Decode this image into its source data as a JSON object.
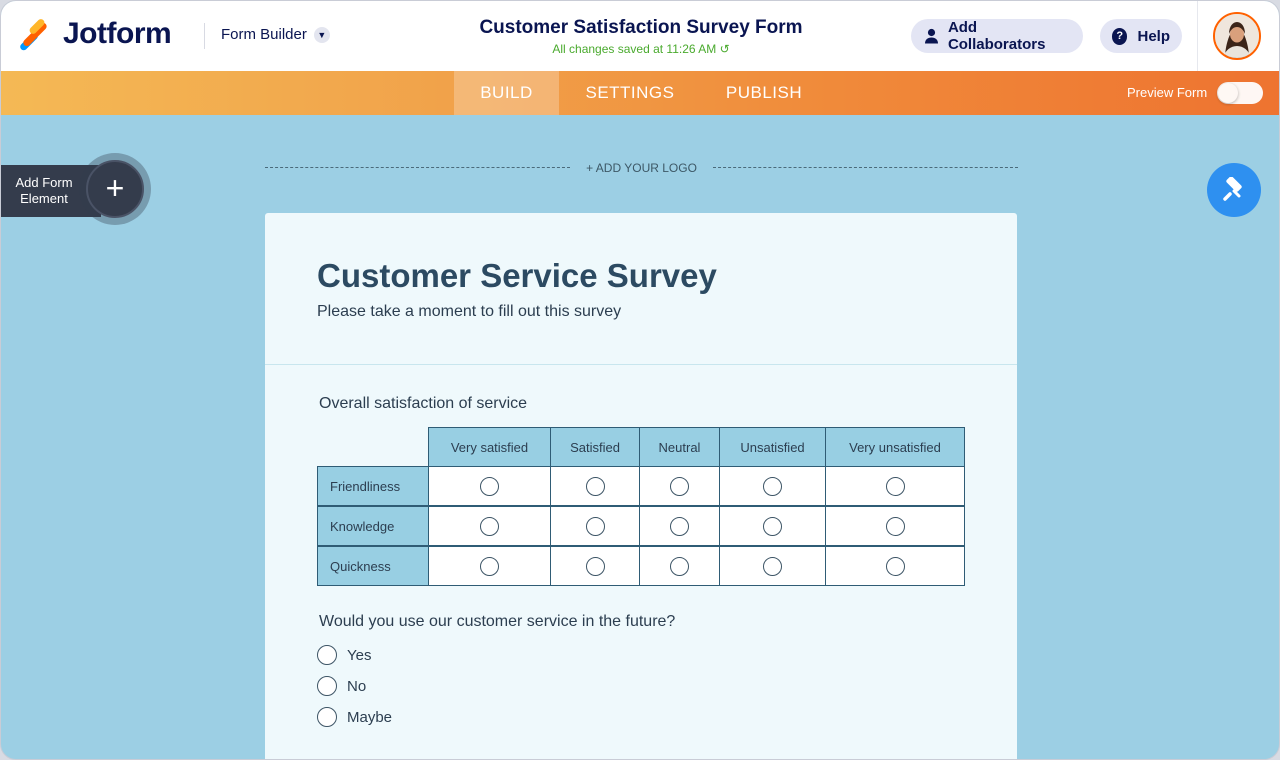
{
  "header": {
    "brand": "Jotform",
    "builder_label": "Form Builder",
    "form_title": "Customer Satisfaction Survey Form",
    "saved_status": "All changes saved at 11:26 AM",
    "collaborators_label": "Add Collaborators",
    "help_label": "Help"
  },
  "nav": {
    "tabs": [
      {
        "label": "BUILD"
      },
      {
        "label": "SETTINGS"
      },
      {
        "label": "PUBLISH"
      }
    ],
    "preview_label": "Preview Form"
  },
  "sidebar": {
    "add_element_line1": "Add Form",
    "add_element_line2": "Element",
    "add_glyph": "+"
  },
  "canvas": {
    "add_logo": "+ ADD YOUR LOGO"
  },
  "form": {
    "title": "Customer Service Survey",
    "subtitle": "Please take a moment to fill out this survey",
    "q1": {
      "label": "Overall satisfaction of service",
      "columns": [
        "Very satisfied",
        "Satisfied",
        "Neutral",
        "Unsatisfied",
        "Very unsatisfied"
      ],
      "rows": [
        "Friendliness",
        "Knowledge",
        "Quickness"
      ]
    },
    "q2": {
      "label": "Would you use our customer service in the future?",
      "options": [
        "Yes",
        "No",
        "Maybe"
      ]
    }
  },
  "colors": {
    "brand_navy": "#0a1551",
    "accent_orange": "#ff6100",
    "saved_green": "#4aaa2e",
    "canvas_blue": "#9ccfe4",
    "paint_blue": "#2e90f0"
  },
  "icons": {
    "collaborators": "user-icon",
    "help": "question-icon",
    "saved": "refresh-icon",
    "builder": "chevron-down-icon",
    "designer": "paint-roller-icon"
  }
}
